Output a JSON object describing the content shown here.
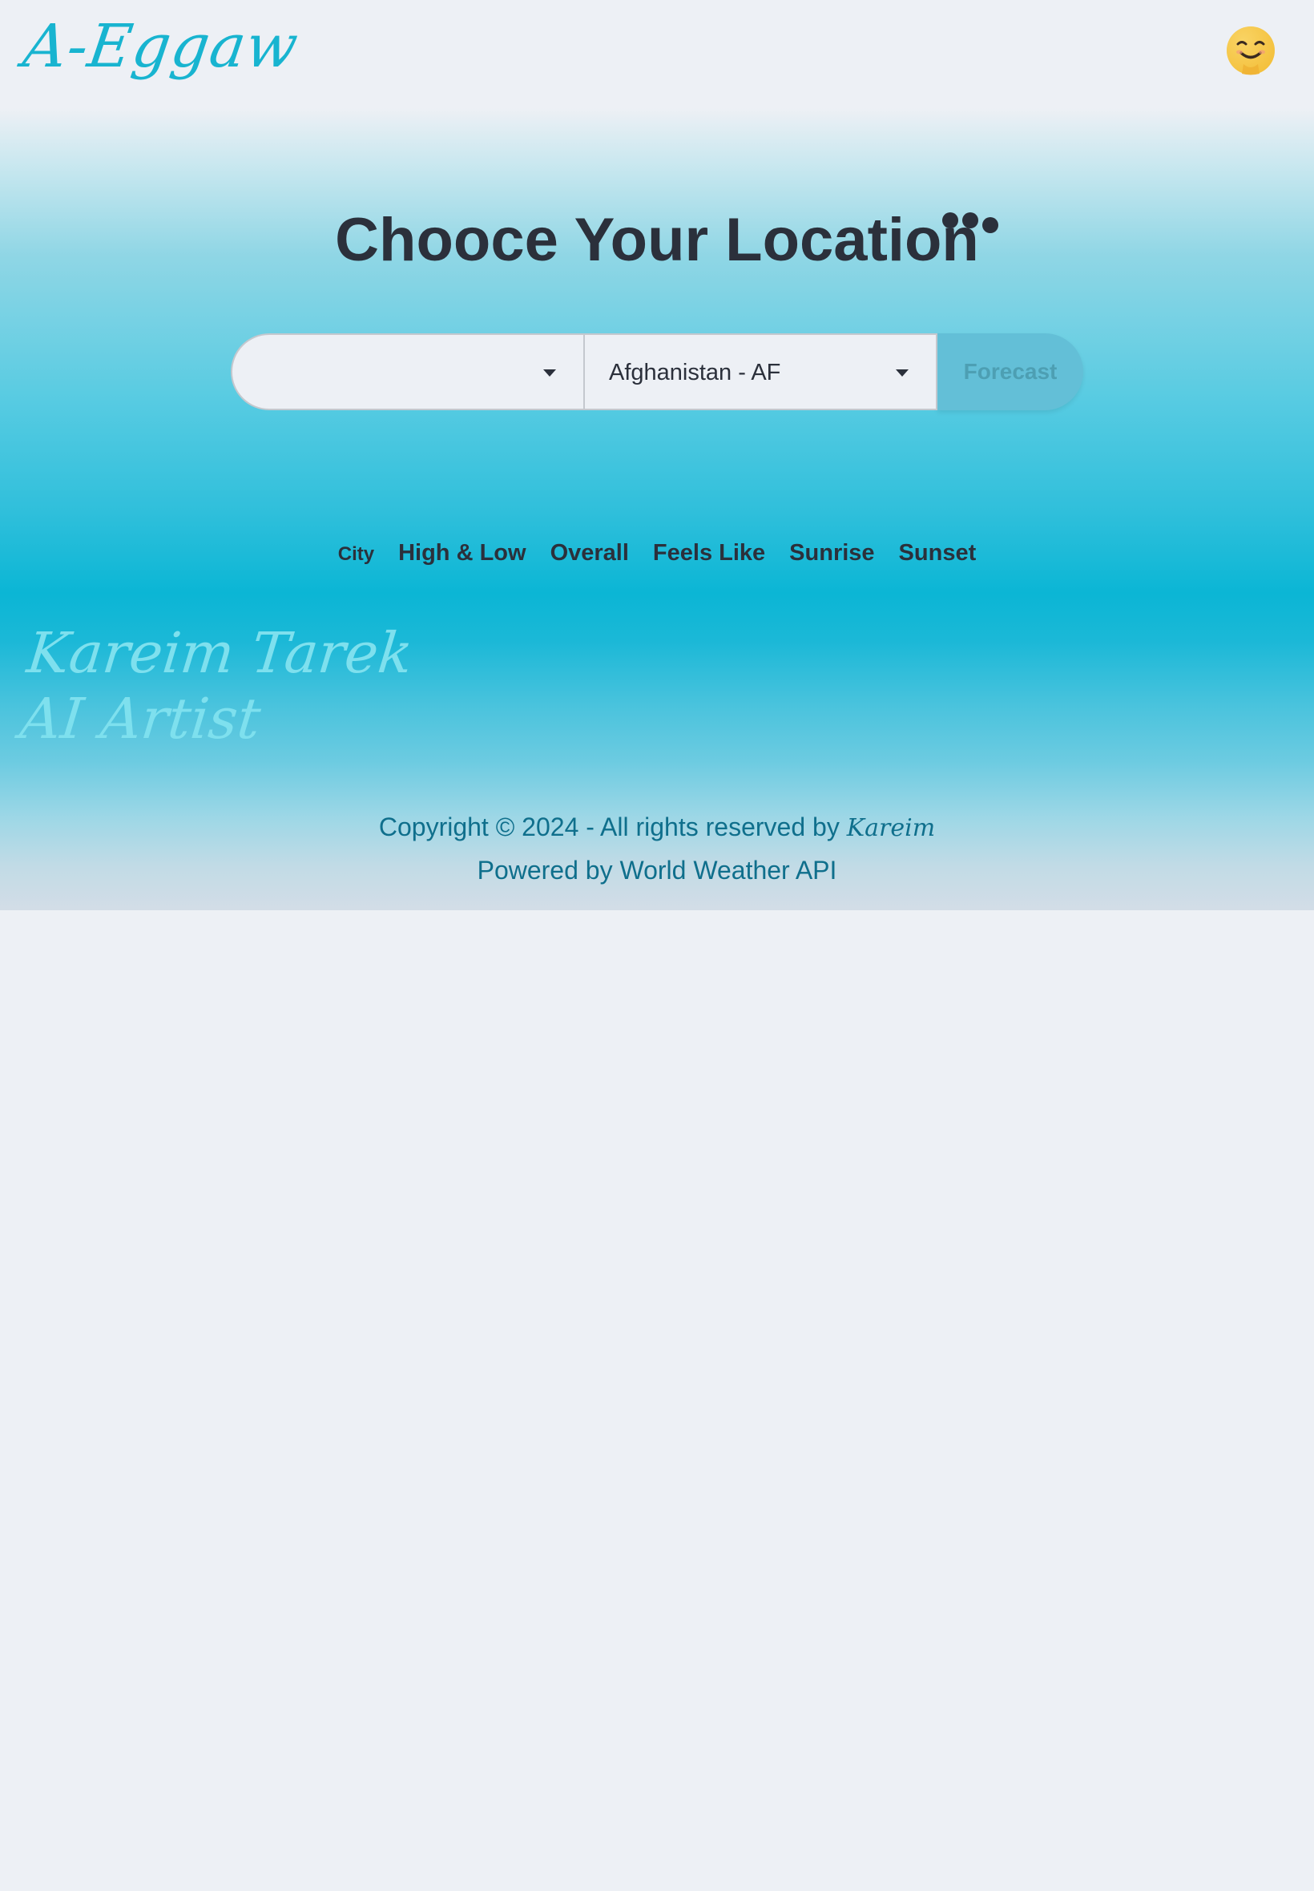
{
  "header": {
    "logo": "A-Eggaw",
    "avatar_icon": "smiling-face-icon"
  },
  "main": {
    "title": "Chooce Your Location",
    "loading_icon": "loading-dots-icon"
  },
  "search": {
    "city_value": "",
    "country_value": "Afghanistan - AF",
    "forecast_label": "Forecast"
  },
  "columns": [
    "City",
    "High & Low",
    "Overall",
    "Feels Like",
    "Sunrise",
    "Sunset"
  ],
  "signature": {
    "line1": "Kareim Tarek",
    "line2": "AI Artist"
  },
  "footer": {
    "copyright_prefix": "Copyright © 2024 - All rights reserved by",
    "copyright_name": "Kareim",
    "powered_by": "Powered by World Weather API"
  },
  "colors": {
    "brand": "#18b4d0",
    "text": "#2b303b",
    "footer_text": "#0f6f8c",
    "background": "#edf0f5"
  }
}
